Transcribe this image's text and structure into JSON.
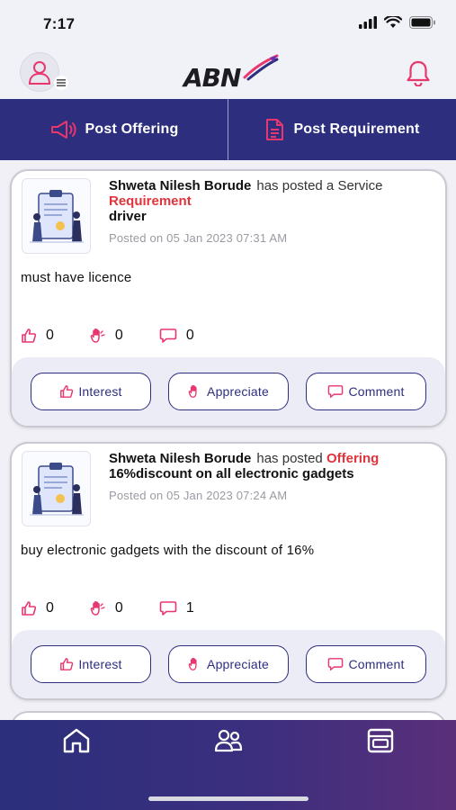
{
  "status_bar": {
    "time": "7:17"
  },
  "header": {
    "logo_text": "ABN",
    "avatar_icon": "user-avatar-icon",
    "notification_icon": "bell-icon"
  },
  "post_bar": {
    "offering_label": "Post Offering",
    "requirement_label": "Post Requirement"
  },
  "colors": {
    "primary": "#2d2f7e",
    "accent": "#e0343c",
    "icon_pink": "#e8366e"
  },
  "feed": [
    {
      "author": "Shweta Nilesh Borude",
      "posted_prefix": "has posted a Service",
      "kind": "Requirement",
      "title": "driver",
      "timestamp": "Posted on 05 Jan 2023 07:31 AM",
      "body": "must have licence",
      "likes": "0",
      "appreciations": "0",
      "comments": "0",
      "interest_label": "Interest",
      "appreciate_label": "Appreciate",
      "comment_label": "Comment"
    },
    {
      "author": "Shweta Nilesh Borude",
      "posted_prefix": "has posted",
      "kind": "Offering",
      "title": "16%discount on all electronic gadgets",
      "timestamp": "Posted on 05 Jan 2023 07:24 AM",
      "body": "buy electronic gadgets with the discount of 16%",
      "likes": "0",
      "appreciations": "0",
      "comments": "1",
      "interest_label": "Interest",
      "appreciate_label": "Appreciate",
      "comment_label": "Comment"
    }
  ],
  "bottom_nav": {
    "items": [
      "home-icon",
      "people-icon",
      "card-icon"
    ]
  }
}
